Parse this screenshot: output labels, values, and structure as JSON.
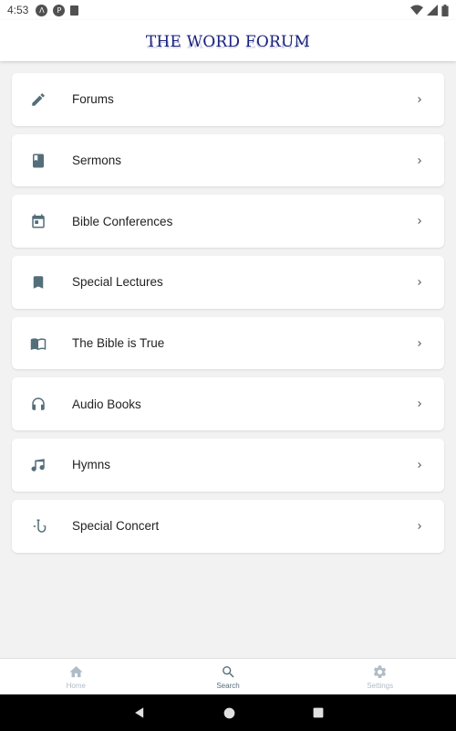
{
  "status_bar": {
    "time": "4:53",
    "left_icons": [
      "a-icon",
      "p-icon",
      "sim-icon"
    ],
    "right_icons": [
      "wifi-icon",
      "signal-icon",
      "battery-icon"
    ]
  },
  "header": {
    "logo_text": "THE WORD FORUM"
  },
  "menu": {
    "items": [
      {
        "label": "Forums",
        "icon": "pencil-icon"
      },
      {
        "label": "Sermons",
        "icon": "book-icon"
      },
      {
        "label": "Bible Conferences",
        "icon": "calendar-icon"
      },
      {
        "label": "Special Lectures",
        "icon": "bookmark-icon"
      },
      {
        "label": "The Bible is True",
        "icon": "open-book-icon"
      },
      {
        "label": "Audio Books",
        "icon": "headphones-icon"
      },
      {
        "label": "Hymns",
        "icon": "music-note-icon"
      },
      {
        "label": "Special Concert",
        "icon": "saxophone-icon"
      }
    ]
  },
  "bottom_nav": {
    "items": [
      {
        "label": "Home",
        "icon": "home-icon",
        "active": false
      },
      {
        "label": "Search",
        "icon": "search-icon",
        "active": true
      },
      {
        "label": "Settings",
        "icon": "gear-icon",
        "active": false
      }
    ]
  },
  "colors": {
    "icon": "#546e7a",
    "logo": "#1a237e",
    "inactive_nav": "#b0bcc6",
    "background": "#f2f2f2"
  }
}
